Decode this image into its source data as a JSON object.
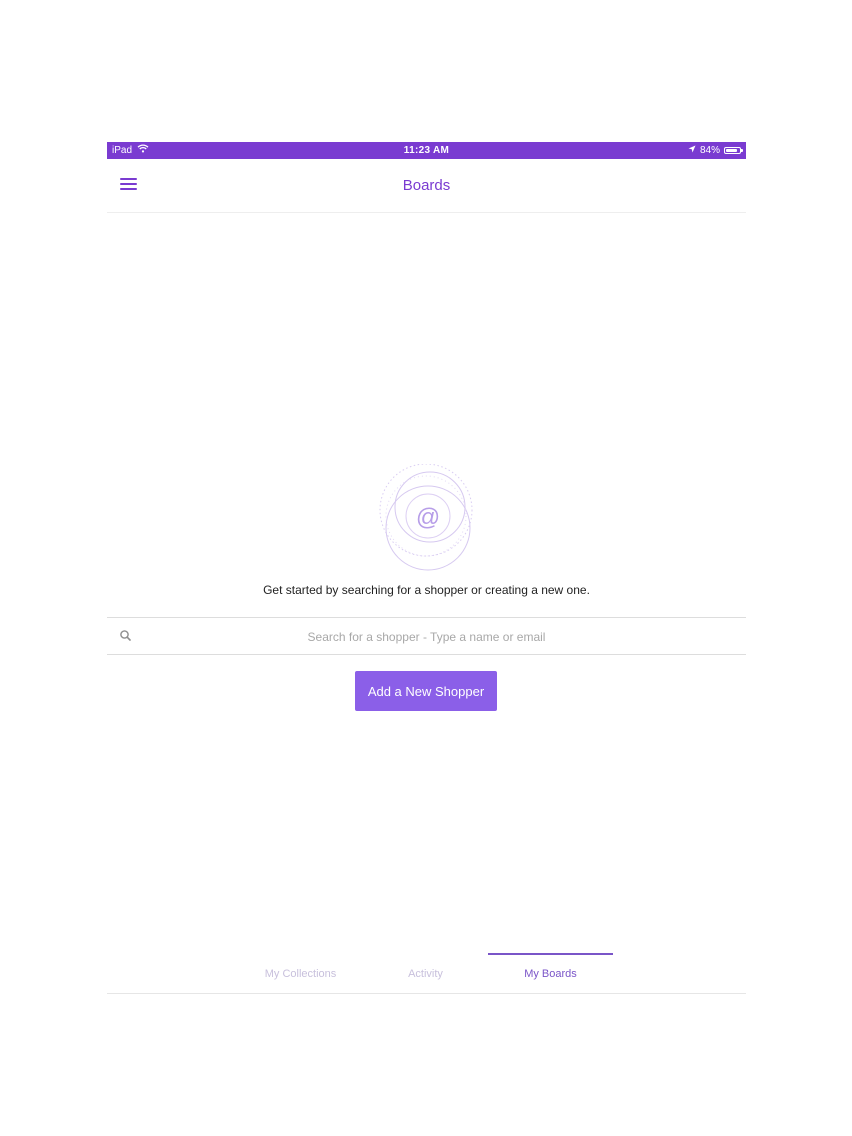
{
  "status_bar": {
    "device": "iPad",
    "time": "11:23 AM",
    "battery": "84%",
    "battery_level": 0.84,
    "icons": [
      "wifi-icon",
      "location-arrow-icon",
      "battery-icon"
    ],
    "background_color": "#7a3bd1"
  },
  "nav": {
    "title": "Boards",
    "menu_icon": "hamburger-menu-icon"
  },
  "empty_state": {
    "illustration_icon": "at-sign-circles-icon",
    "message": "Get started by searching for a shopper or creating a new one."
  },
  "search": {
    "placeholder": "Search for a shopper - Type a name or email",
    "value": "",
    "icon": "search-icon"
  },
  "add_button": {
    "label": "Add a New Shopper"
  },
  "tabs": [
    {
      "label": "My Collections",
      "active": false
    },
    {
      "label": "Activity",
      "active": false
    },
    {
      "label": "My Boards",
      "active": true
    }
  ],
  "colors": {
    "accent": "#7a3bd1",
    "button": "#8b5fe8"
  }
}
